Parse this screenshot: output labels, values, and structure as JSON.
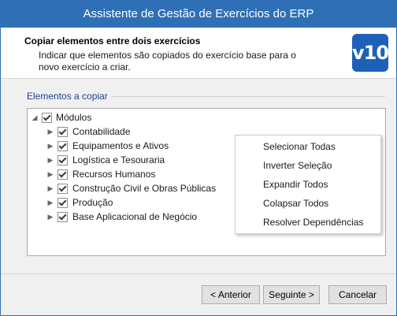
{
  "window": {
    "title": "Assistente de Gestão de Exercícios do ERP"
  },
  "header": {
    "title": "Copiar elementos entre dois exercícios",
    "subtitle": "Indicar que elementos são copiados do exercício base para o novo exercício a criar.",
    "logo_text": "v10",
    "logo_color": "#1e60b8"
  },
  "section": {
    "label": "Elementos a copiar"
  },
  "tree": {
    "root": {
      "label": "Módulos",
      "checked": true,
      "expanded": true
    },
    "items": [
      {
        "label": "Contabilidade",
        "checked": true
      },
      {
        "label": "Equipamentos e Ativos",
        "checked": true
      },
      {
        "label": "Logística e Tesouraria",
        "checked": true
      },
      {
        "label": "Recursos Humanos",
        "checked": true
      },
      {
        "label": "Construção Civil e Obras Públicas",
        "checked": true
      },
      {
        "label": "Produção",
        "checked": true
      },
      {
        "label": "Base Aplicacional de Negócio",
        "checked": true
      }
    ]
  },
  "context_menu": {
    "items": [
      {
        "label": "Selecionar Todas"
      },
      {
        "label": "Inverter Seleção"
      },
      {
        "label": "Expandir Todos"
      },
      {
        "label": "Colapsar Todos"
      },
      {
        "label": "Resolver Dependências"
      }
    ]
  },
  "buttons": {
    "back": "< Anterior",
    "next": "Seguinte >",
    "cancel": "Cancelar"
  },
  "colors": {
    "titlebar": "#2f6fb5",
    "accent_text": "#1f3f99"
  }
}
